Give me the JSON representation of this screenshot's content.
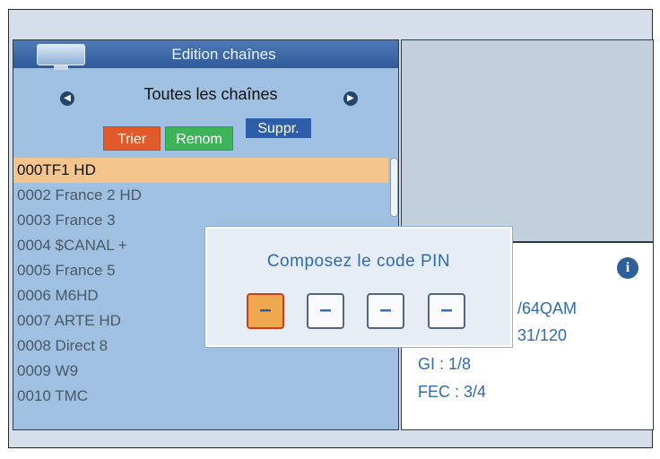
{
  "header": {
    "title": "Edition chaînes",
    "filter_label": "Toutes les chaînes",
    "tv_icon": "tv-icon",
    "prev_icon": "arrow-left-icon",
    "next_icon": "arrow-right-icon"
  },
  "buttons": {
    "sort": "Trier",
    "rename": "Renom",
    "delete": "Suppr."
  },
  "channels": [
    "000TF1 HD",
    "0002 France 2 HD",
    "0003 France 3",
    "0004 $CANAL +",
    "0005 France 5",
    "0006 M6HD",
    "0007 ARTE HD",
    "0008 Direct 8",
    "0009 W9",
    "0010 TMC"
  ],
  "selected_channel_index": 0,
  "info_panel": {
    "icon": "info-icon",
    "lines": [
      "/64QAM",
      "31/120",
      "GI : 1/8",
      "FEC : 3/4"
    ]
  },
  "pin_dialog": {
    "title": "Composez le code PIN",
    "digits": [
      "–",
      "–",
      "–",
      "–"
    ],
    "active_index": 0
  },
  "colors": {
    "accent_orange": "#e25a2a",
    "accent_green": "#3fb35a",
    "accent_blue": "#2e5ea8",
    "selection": "#f3c48c",
    "info_text": "#2e6bb5"
  }
}
